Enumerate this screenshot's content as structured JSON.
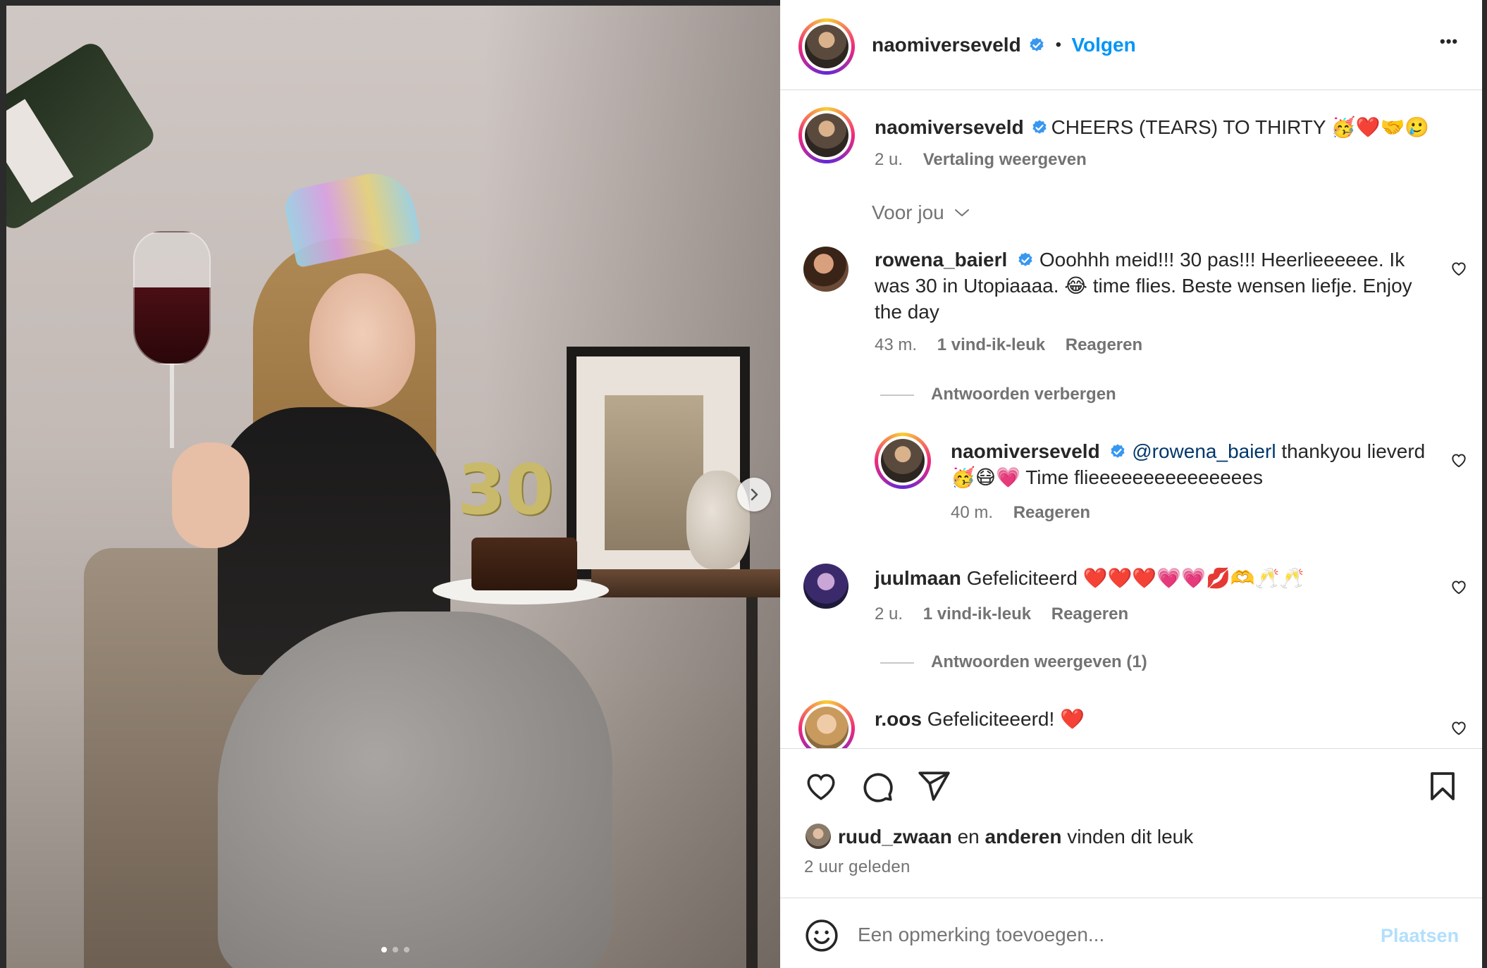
{
  "post": {
    "author": "naomiverseveld",
    "follow_label": "Volgen",
    "separator": "•",
    "more_label": "•••",
    "caption": "CHEERS (TEARS) TO THIRTY 🥳❤️🤝🥲",
    "caption_time": "2 u.",
    "translate_label": "Vertaling weergeven",
    "photo_candle_text": "30"
  },
  "filter": {
    "label": "Voor jou"
  },
  "comments": [
    {
      "user": "rowena_baierl",
      "verified": true,
      "text": "Ooohhh meid!!! 30 pas!!! Heerlieeeeee. Ik was 30 in Utopiaaaa. 😂 time flies. Beste wensen liefje. Enjoy the day",
      "time": "43 m.",
      "likes": "1 vind-ik-leuk",
      "reply_label": "Reageren",
      "toggle_replies": "Antwoorden verbergen"
    },
    {
      "user": "naomiverseveld",
      "verified": true,
      "mention": "@rowena_baierl",
      "text": "thankyou lieverd 🥳😷💗 Time flieeeeeeeeeeeeeees",
      "time": "40 m.",
      "reply_label": "Reageren"
    },
    {
      "user": "juulmaan",
      "verified": false,
      "text": "Gefeliciteerd ❤️❤️❤️💗💗💋🫶🥂🥂",
      "time": "2 u.",
      "likes": "1 vind-ik-leuk",
      "reply_label": "Reageren",
      "toggle_replies": "Antwoorden weergeven (1)"
    },
    {
      "user": "r.oos",
      "verified": false,
      "text": "Gefeliciteeerd! ❤️"
    }
  ],
  "likes": {
    "liker": "ruud_zwaan",
    "connector": "en",
    "others": "anderen",
    "suffix": "vinden dit leuk",
    "time_ago": "2 uur geleden"
  },
  "composer": {
    "placeholder": "Een opmerking toevoegen...",
    "post_label": "Plaatsen"
  },
  "colors": {
    "link_blue": "#0095f6",
    "verified_blue": "#3897f0",
    "meta_gray": "#737373",
    "post_button_disabled": "#b2dffc"
  }
}
